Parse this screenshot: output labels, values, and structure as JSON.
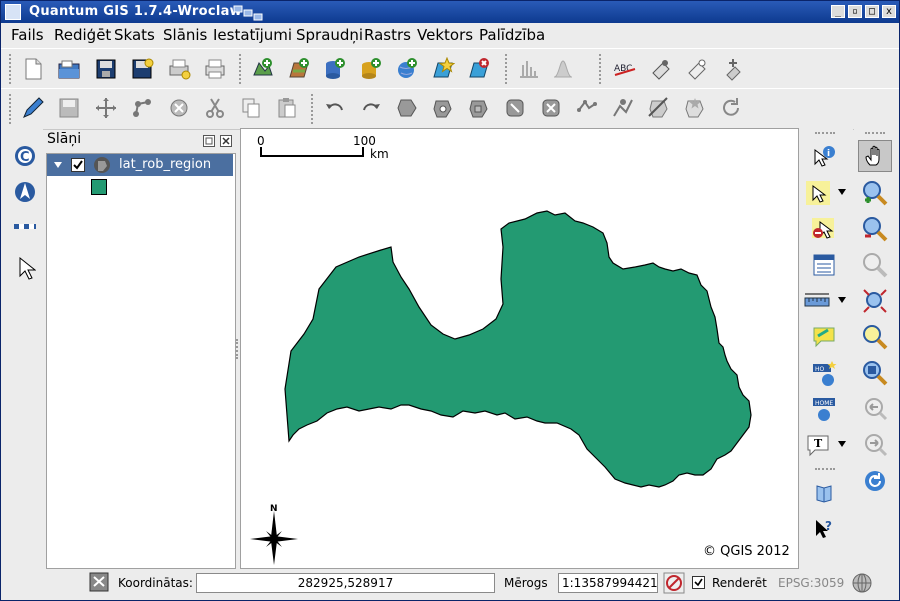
{
  "window": {
    "title": "Quantum GIS 1.7.4-Wroclaw",
    "controls": {
      "minimize": "_",
      "restore": "▫",
      "maximize": "□",
      "close": "x"
    }
  },
  "menubar": {
    "items": [
      "Fails",
      "Rediģēt",
      "Skats",
      "Slānis",
      "Iestatījumi",
      "Spraudņi",
      "Rastrs",
      "Vektors",
      "Palīdzība"
    ]
  },
  "layers_panel": {
    "title": "Slāņi",
    "layers": [
      {
        "name": "lat_rob_region",
        "checked": true,
        "fill_color": "#239a72"
      }
    ]
  },
  "map": {
    "scalebar": {
      "start": "0",
      "end": "100",
      "unit": "km"
    },
    "north_label": "N",
    "copyright": "© QGIS 2012",
    "feature_color": "#239a72"
  },
  "statusbar": {
    "coordinates_label": "Koordinātas:",
    "coordinates_value": "282925,528917",
    "scale_label": "Mērogs",
    "scale_value": "1:13587994421",
    "render_label": "Renderēt",
    "render_checked": true,
    "crs": "EPSG:3059"
  },
  "toolbar_icons": {
    "file": [
      "new-project-icon",
      "open-project-icon",
      "save-project-icon",
      "save-as-icon",
      "print-composer-icon",
      "composer-manager-icon"
    ],
    "layers": [
      "add-vector-icon",
      "add-raster-icon",
      "add-postgis-icon",
      "add-spatialite-icon",
      "add-wms-icon",
      "new-shapefile-icon",
      "remove-layer-icon"
    ],
    "raster": [
      "histogram-stretch-icon",
      "local-histogram-icon"
    ],
    "labels": [
      "label-tool-icon",
      "pin-labels-icon",
      "show-hide-labels-icon",
      "move-label-icon"
    ],
    "digitize": [
      "toggle-edit-icon",
      "save-edits-icon",
      "add-feature-icon",
      "move-feature-icon",
      "node-tool-icon",
      "delete-selected-icon",
      "cut-features-icon",
      "copy-features-icon",
      "paste-features-icon"
    ],
    "advanced": [
      "undo-icon",
      "redo-icon",
      "simplify-icon",
      "add-ring-icon",
      "add-part-icon",
      "delete-ring-icon",
      "delete-part-icon",
      "reshape-icon",
      "offset-curve-icon",
      "split-features-icon",
      "merge-features-icon",
      "merge-attributes-icon",
      "rotate-point-icon"
    ]
  }
}
